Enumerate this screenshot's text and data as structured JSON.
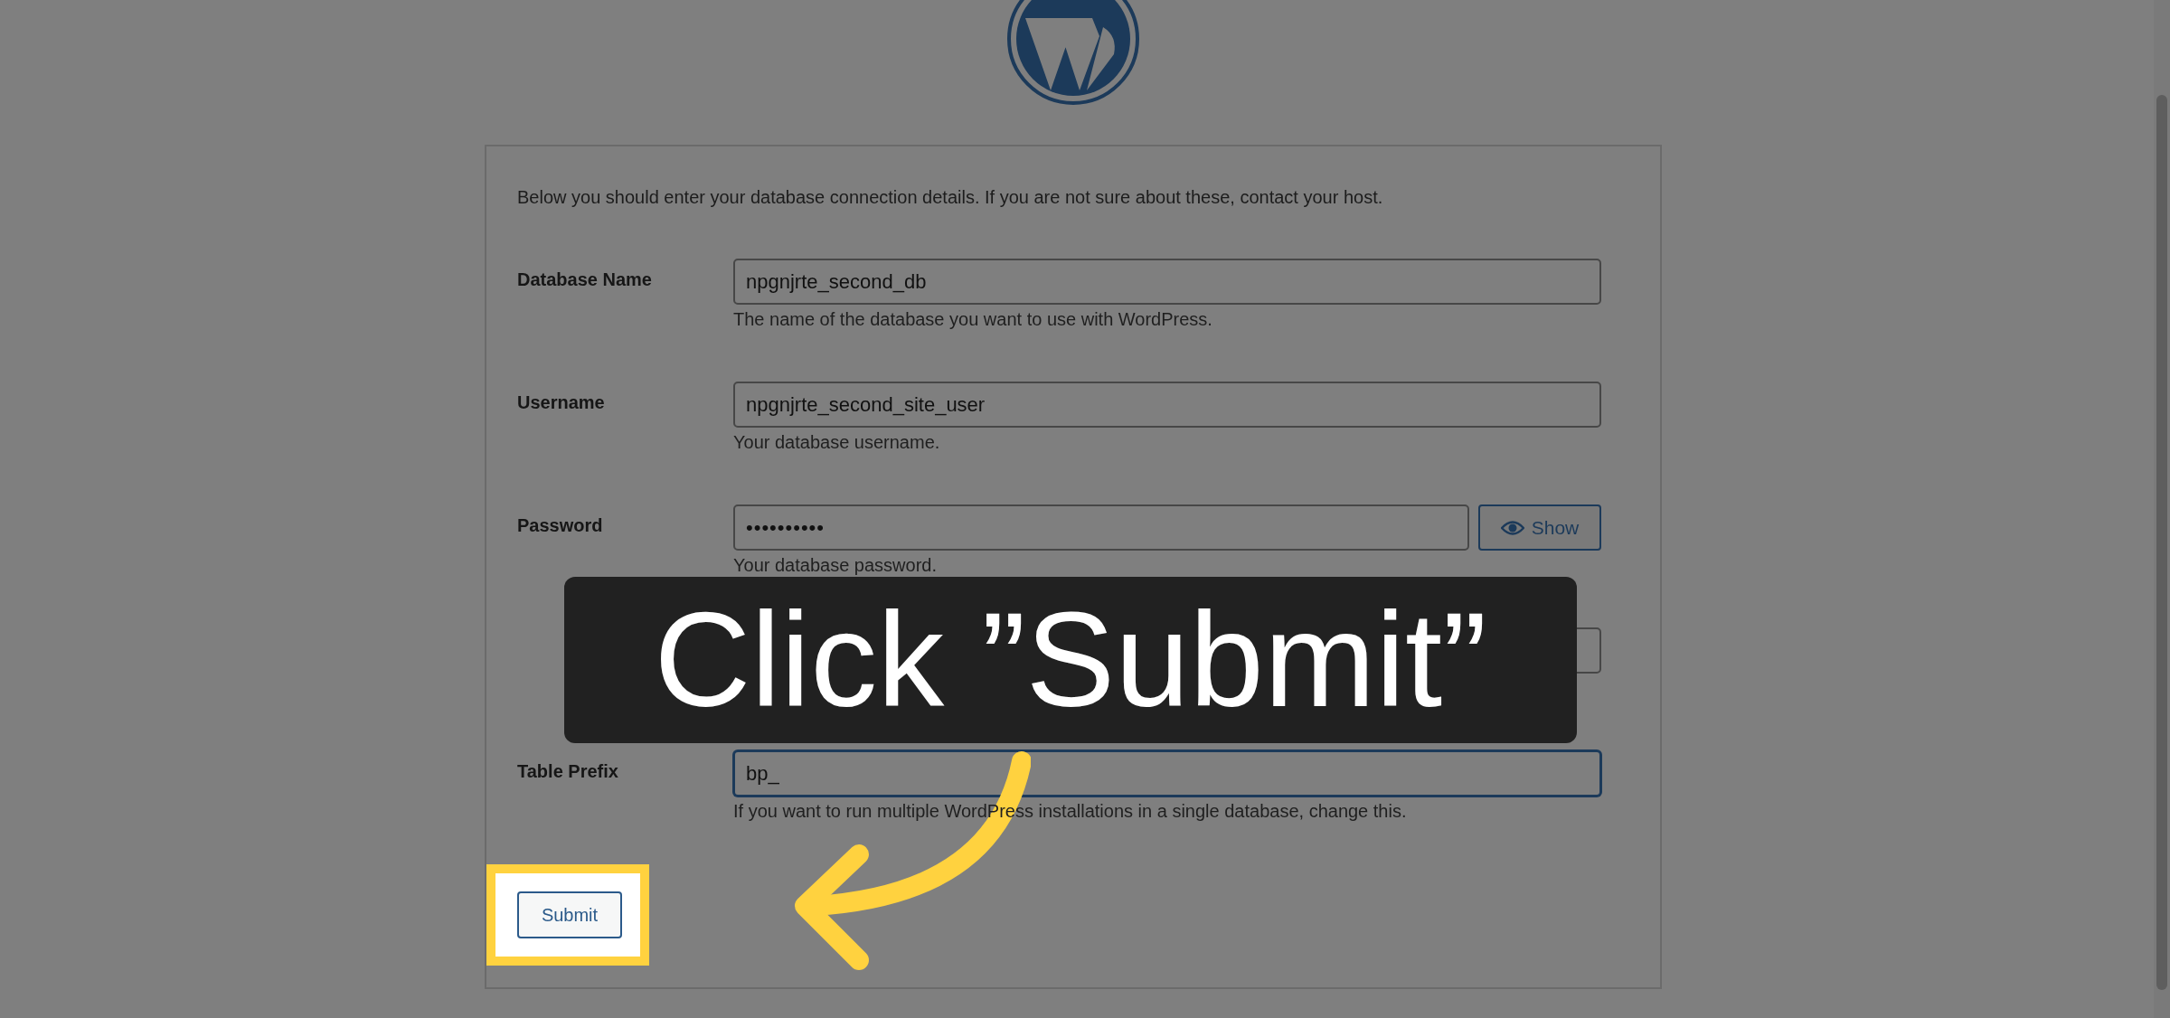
{
  "intro": "Below you should enter your database connection details. If you are not sure about these, contact your host.",
  "fields": [
    {
      "kind": "text",
      "label": "Database Name",
      "value": "npgnjrte_second_db",
      "hint": "The name of the database you want to use with WordPress.",
      "focused": false
    },
    {
      "kind": "text",
      "label": "Username",
      "value": "npgnjrte_second_site_user",
      "hint": "Your database username.",
      "focused": false
    },
    {
      "kind": "password",
      "label": "Password",
      "value": "••••••••••",
      "hint": "Your database password.",
      "focused": false,
      "button": "Show"
    },
    {
      "kind": "covered",
      "focused": false
    },
    {
      "kind": "text",
      "label": "Table Prefix",
      "value": "bp_",
      "hint": "If you want to run multiple WordPress installations in a single database, change this.",
      "focused": true
    }
  ],
  "submit": {
    "label": "Submit",
    "highlighted": true
  },
  "callout": {
    "text": "Click ”Submit”"
  }
}
